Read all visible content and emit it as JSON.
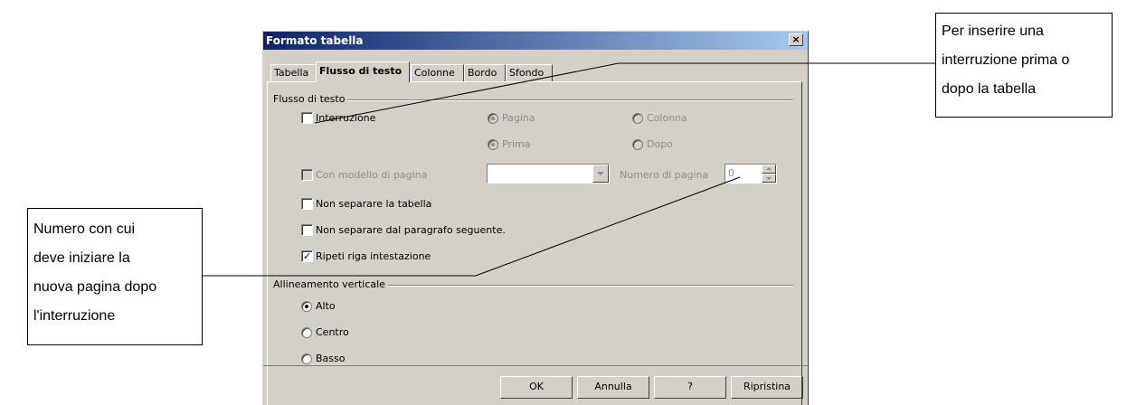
{
  "dialog": {
    "title": "Formato tabella",
    "close_glyph": "×",
    "tabs": [
      {
        "label": "Tabella",
        "active": false
      },
      {
        "label": "Flusso di testo",
        "active": true
      },
      {
        "label": "Colonne",
        "active": false
      },
      {
        "label": "Bordo",
        "active": false
      },
      {
        "label": "Sfondo",
        "active": false
      }
    ]
  },
  "flow_group": {
    "label": "Flusso di testo",
    "break_checkbox": {
      "label": "Interruzione",
      "checked": false
    },
    "type_radios": [
      {
        "label": "Pagina",
        "checked": true,
        "enabled": false
      },
      {
        "label": "Colonna",
        "checked": false,
        "enabled": false
      }
    ],
    "position_radios": [
      {
        "label": "Prima",
        "checked": true,
        "enabled": false
      },
      {
        "label": "Dopo",
        "checked": false,
        "enabled": false
      }
    ],
    "page_style_checkbox": {
      "label": "Con modello di pagina",
      "checked": false,
      "enabled": false
    },
    "page_style_value": "",
    "page_number_label": "Numero di pagina",
    "page_number_value": "0",
    "no_split_table": {
      "label": "Non separare la tabella",
      "checked": false
    },
    "keep_with_next": {
      "label": "Non separare dal paragrafo seguente.",
      "checked": false
    },
    "repeat_heading": {
      "label": "Ripeti riga intestazione",
      "checked": true
    }
  },
  "vertical_group": {
    "label": "Allineamento verticale",
    "options": [
      {
        "label": "Alto",
        "checked": true
      },
      {
        "label": "Centro",
        "checked": false
      },
      {
        "label": "Basso",
        "checked": false
      }
    ]
  },
  "buttons": {
    "ok": "OK",
    "cancel": "Annulla",
    "help": "?",
    "reset": "Ripristina"
  },
  "callouts": {
    "top_right": [
      "Per inserire una",
      "interruzione prima o",
      "dopo la tabella"
    ],
    "left": [
      "Numero con cui",
      "deve iniziare la",
      "nuova pagina dopo",
      "l'interruzione"
    ]
  },
  "icons": {
    "close": "close-icon",
    "checkmark": "checkmark-icon",
    "dropdown": "chevron-down-icon",
    "spin": "spin-arrows-icon"
  }
}
